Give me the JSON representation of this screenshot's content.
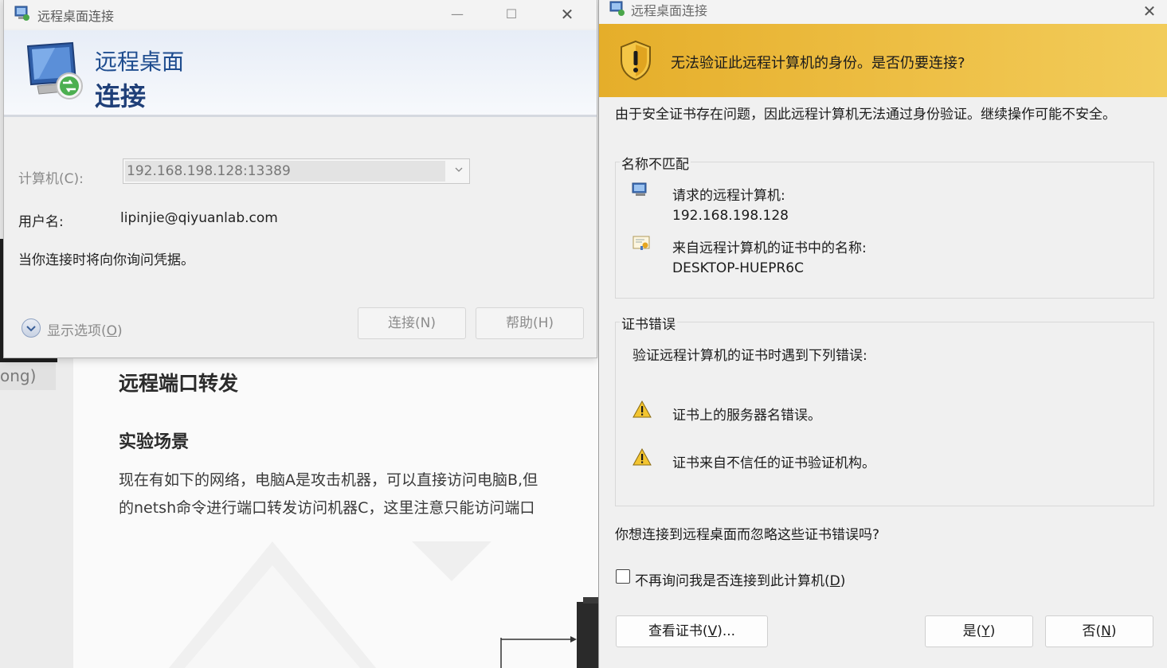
{
  "background": {
    "sidebar_fragment": "ong)",
    "heading": "远程端口转发",
    "subheading": "实验场景",
    "paragraph_lines": [
      "现在有如下的网络，电脑A是攻击机器，可以直接访问电脑B,但",
      "的netsh命令进行端口转发访问机器C，这里注意只能访问端口"
    ]
  },
  "rdp": {
    "window_title": "远程桌面连接",
    "banner_line1": "远程桌面",
    "banner_line2": "连接",
    "computer_label": "计算机(C):",
    "computer_value": "192.168.198.128:13389",
    "username_label": "用户名:",
    "username_value": "lipinjie@qiyuanlab.com",
    "credential_note": "当你连接时将向你询问凭据。",
    "show_options": "显示选项(",
    "show_options_key": "O",
    "show_options_end": ")",
    "connect_button": "连接(N)",
    "help_button": "帮助(H)",
    "controls": {
      "minimize": "—",
      "maximize": "☐",
      "close": "✕"
    }
  },
  "cert_dialog": {
    "window_title": "远程桌面连接",
    "warning_message": "无法验证此远程计算机的身份。是否仍要连接?",
    "intro": "由于安全证书存在问题，因此远程计算机无法通过身份验证。继续操作可能不安全。",
    "name_mismatch": {
      "title": "名称不匹配",
      "requested_label": "请求的远程计算机:",
      "requested_value": "192.168.198.128",
      "cert_name_label": "来自远程计算机的证书中的名称:",
      "cert_name_value": "DESKTOP-HUEPR6C"
    },
    "cert_errors": {
      "title": "证书错误",
      "intro": "验证远程计算机的证书时遇到下列错误:",
      "errors": [
        "证书上的服务器名错误。",
        "证书来自不信任的证书验证机构。"
      ]
    },
    "question": "你想连接到远程桌面而忽略这些证书错误吗?",
    "dont_ask_prefix": "不再询问我是否连接到此计算机(",
    "dont_ask_key": "D",
    "dont_ask_suffix": ")",
    "view_cert_prefix": "查看证书(",
    "view_cert_key": "V",
    "view_cert_suffix": ")...",
    "yes_prefix": "是(",
    "yes_key": "Y",
    "yes_suffix": ")",
    "no_prefix": "否(",
    "no_key": "N",
    "no_suffix": ")",
    "close": "✕"
  },
  "colors": {
    "warning_banner": "#e5ae2a",
    "rdp_title_blue": "#1f4d8f"
  }
}
